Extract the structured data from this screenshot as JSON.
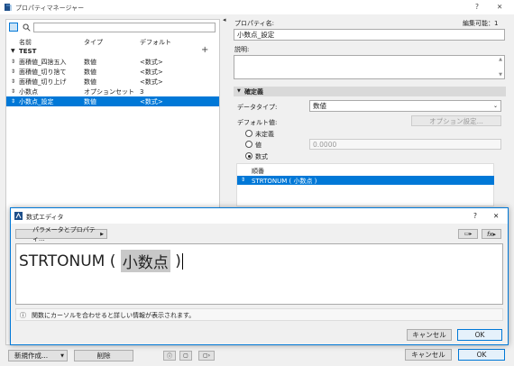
{
  "window": {
    "title": "プロパティマネージャー",
    "help": "?",
    "close": "✕"
  },
  "left": {
    "search_placeholder": "",
    "columns": {
      "name": "名前",
      "type": "タイプ",
      "default": "デフォルト"
    },
    "group": "TEST",
    "rows": [
      {
        "name": "面積値_四捨五入",
        "type": "数値",
        "default": "<数式>"
      },
      {
        "name": "面積値_切り捨て",
        "type": "数値",
        "default": "<数式>"
      },
      {
        "name": "面積値_切り上げ",
        "type": "数値",
        "default": "<数式>"
      },
      {
        "name": "小数点",
        "type": "オプションセット",
        "default": "3"
      },
      {
        "name": "小数点_設定",
        "type": "数値",
        "default": "<数式>"
      }
    ],
    "add": "+",
    "new_button": "新規作成...",
    "delete_button": "削除"
  },
  "right": {
    "edit_status": "編集可能：1",
    "property_name_label": "プロパティ名:",
    "property_name_value": "小数点_設定",
    "description_label": "説明:",
    "definition_header": "確定義",
    "datatype_label": "データタイプ:",
    "datatype_value": "数値",
    "default_label": "デフォルト値:",
    "option_settings_button": "オプション設定...",
    "radio_undefined": "未定義",
    "radio_value": "値",
    "value_placeholder": "0.0000",
    "radio_formula": "数式",
    "order_header": "順番",
    "formula_row": "STRTONUM ( 小数点 )",
    "cancel_button": "キャンセル",
    "ok_button": "OK"
  },
  "formula_editor": {
    "title": "数式エディタ",
    "help": "?",
    "close": "✕",
    "params_button": "パラメータとプロパティ...",
    "formula_prefix": "STRTONUM ( ",
    "formula_param": "小数点",
    "formula_suffix": " )",
    "info_text": "関数にカーソルを合わせると詳しい情報が表示されます。",
    "cancel_button": "キャンセル",
    "ok_button": "OK"
  },
  "colors": {
    "accent": "#0078d7",
    "selection": "#0078d7",
    "param_bg": "#c8c8c8"
  }
}
